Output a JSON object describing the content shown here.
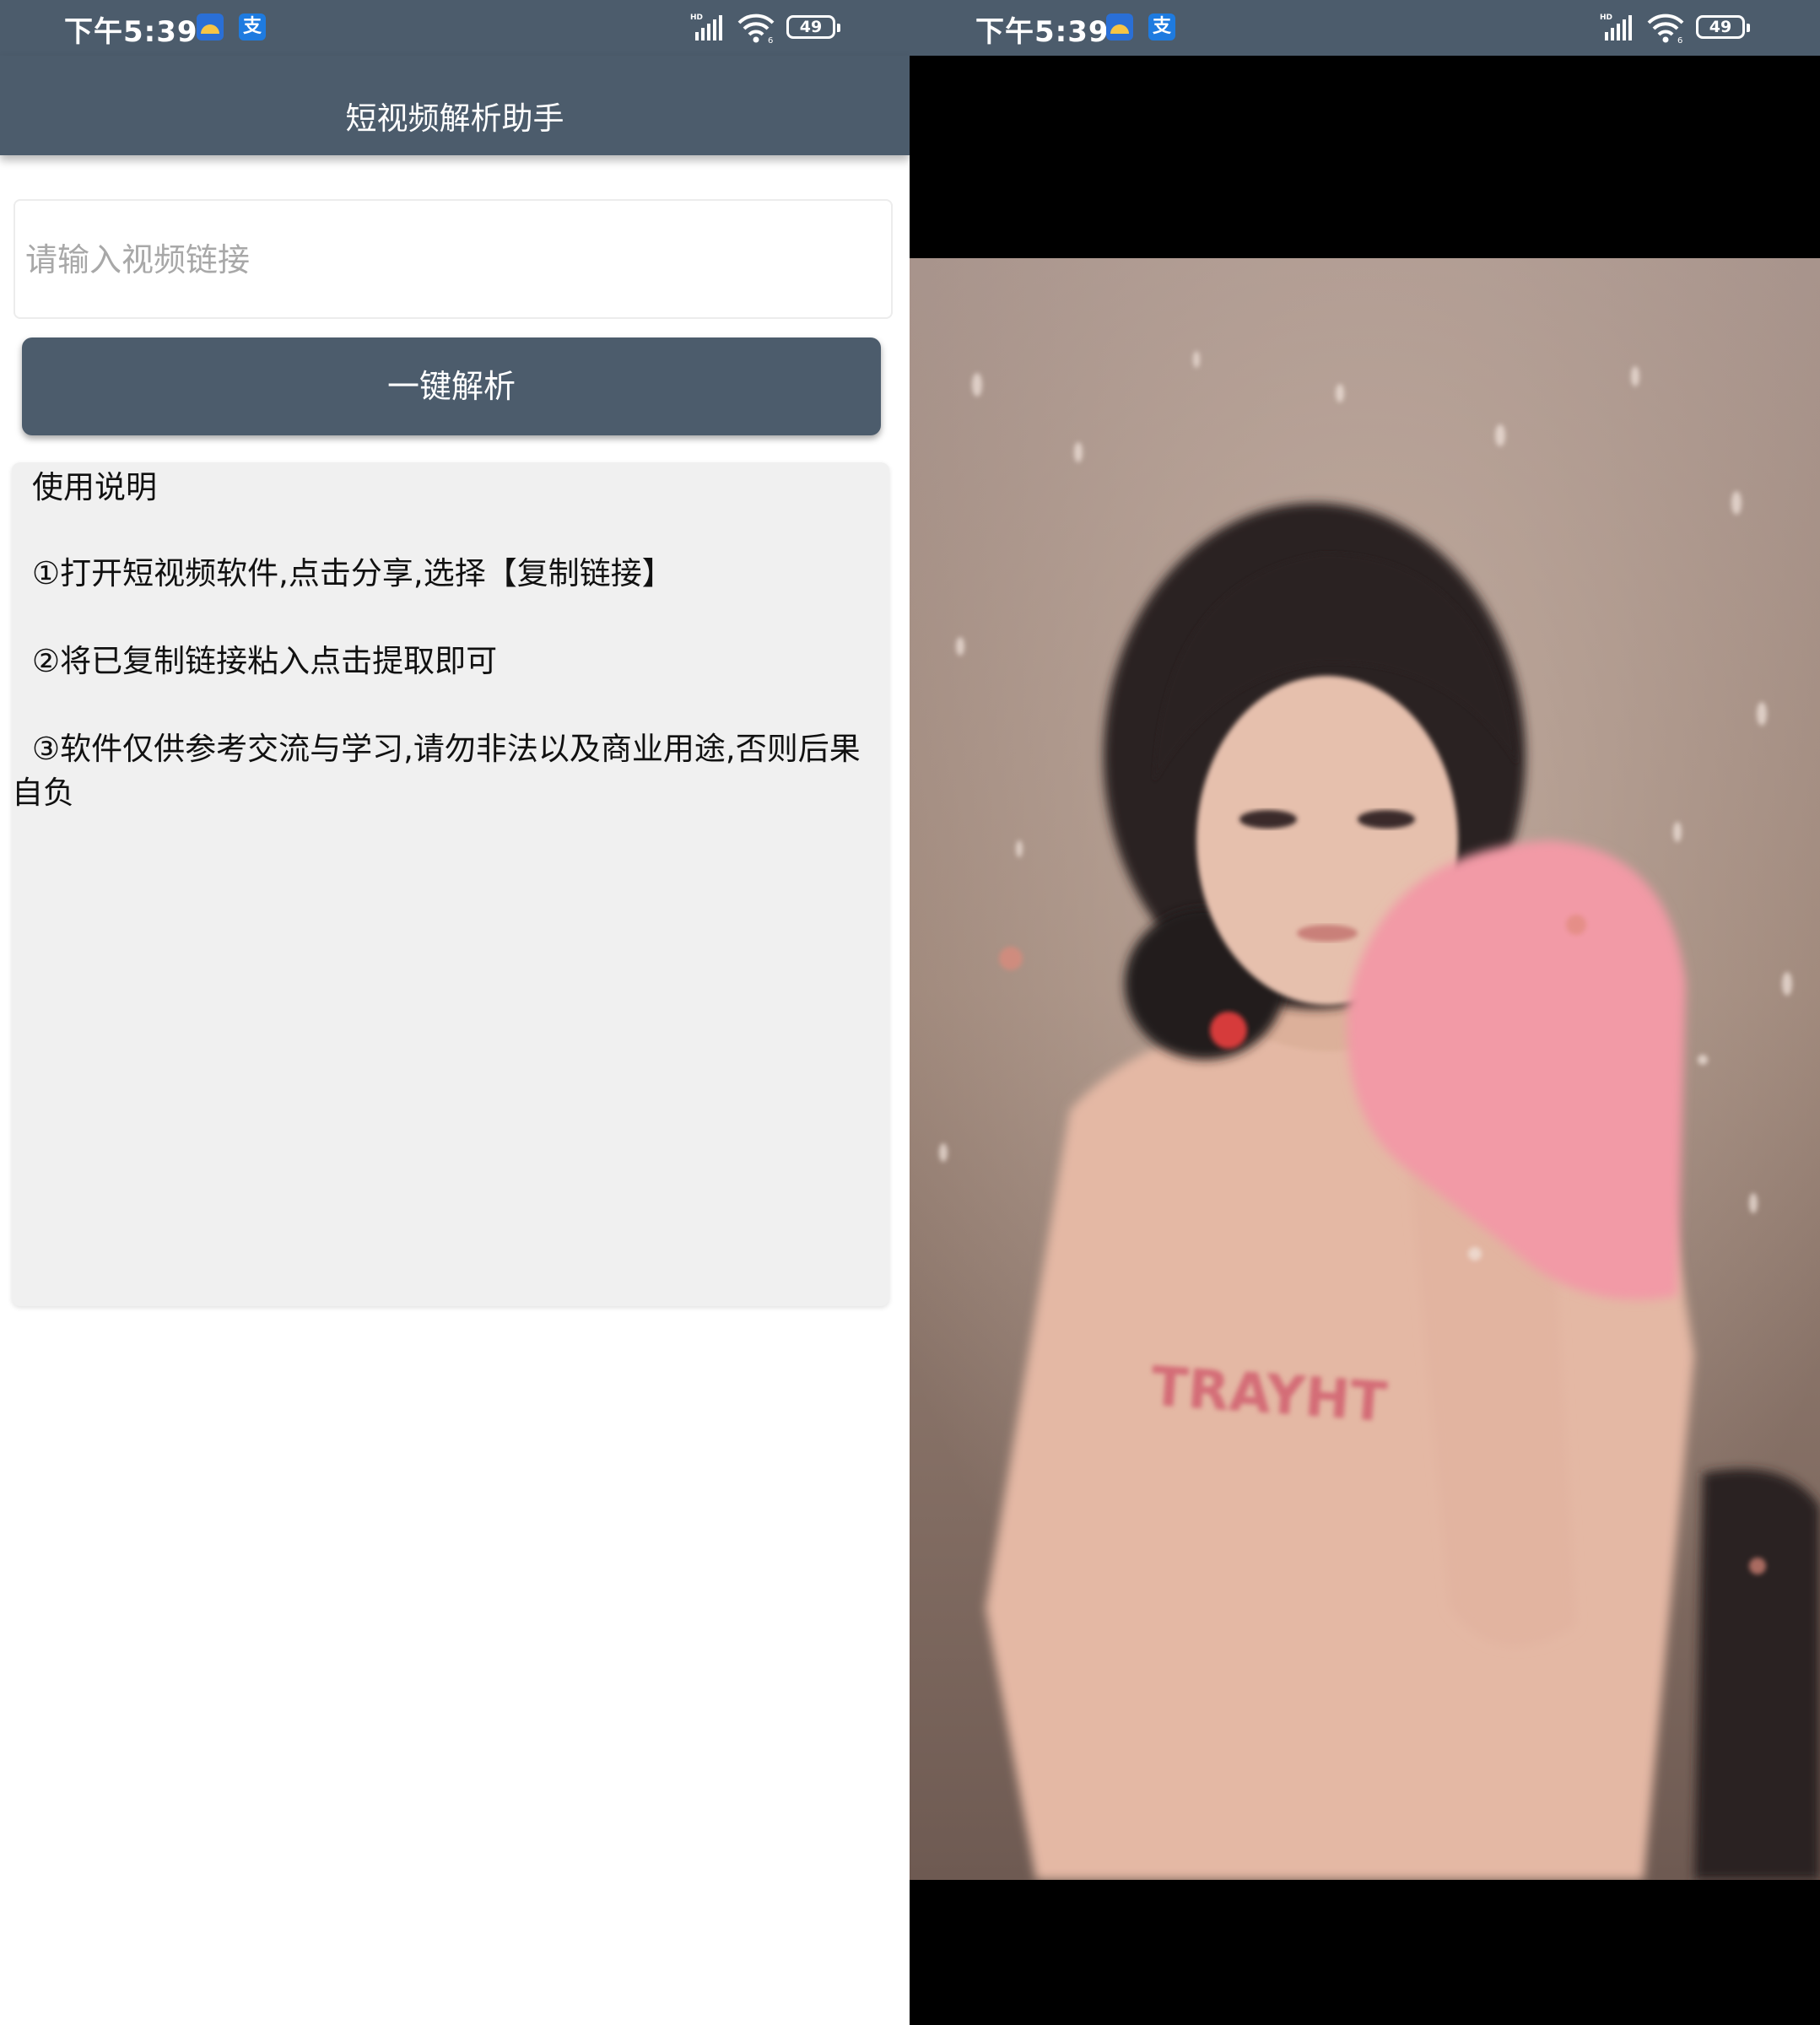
{
  "status_bar": {
    "time": "下午5:39",
    "app_icon_2_glyph": "支",
    "battery": "49",
    "icons": [
      "weather-app-icon",
      "alipay-app-icon",
      "hd-signal-icon",
      "wifi-icon",
      "battery-icon"
    ]
  },
  "left_screen": {
    "title": "短视频解析助手",
    "url_input": {
      "placeholder": "请输入视频链接",
      "value": ""
    },
    "parse_button_label": "一键解析",
    "instructions": {
      "title": "使用说明",
      "steps": [
        "①打开短视频软件,点击分享,选择【复制链接】",
        "②将已复制链接粘入点击提取即可",
        "③软件仅供参考交流与学习,请勿非法以及商业用途,否则后果自负"
      ]
    }
  },
  "right_screen": {
    "video": {
      "shirt_text": "TRAYHT"
    }
  },
  "colors": {
    "app_bar": "#4c5c6c",
    "button": "#4c5c6c",
    "instructions_bg": "#f0f0f0",
    "video_bg": "#000000",
    "placeholder": "#a8a8a8"
  }
}
